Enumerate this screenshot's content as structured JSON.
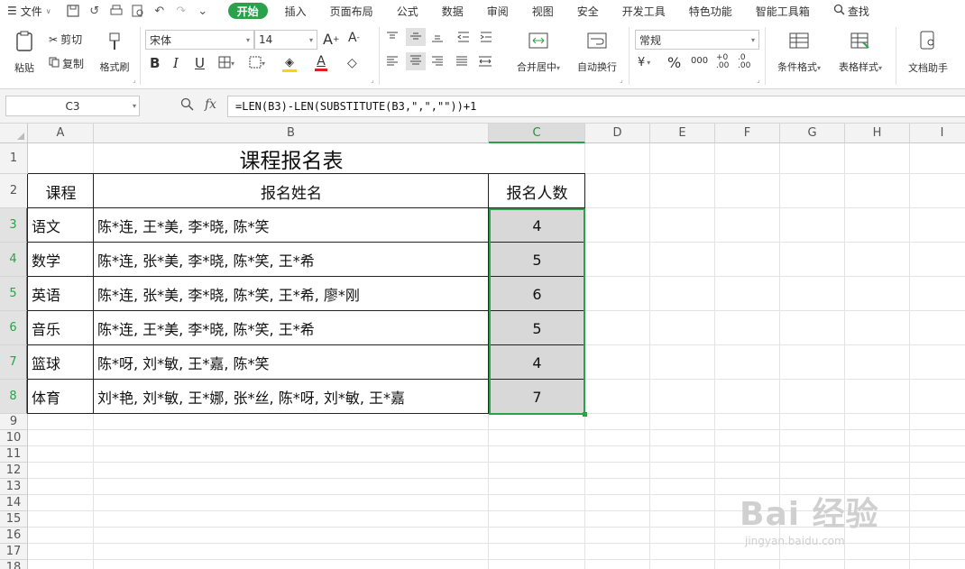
{
  "menubar": {
    "file_label": "文件",
    "tabs": [
      "开始",
      "插入",
      "页面布局",
      "公式",
      "数据",
      "审阅",
      "视图",
      "安全",
      "开发工具",
      "特色功能",
      "智能工具箱"
    ],
    "active_tab": "开始",
    "search_label": "查找"
  },
  "ribbon": {
    "paste": "粘贴",
    "cut": "剪切",
    "copy": "复制",
    "format_painter": "格式刷",
    "font_name": "宋体",
    "font_size": "14",
    "bold": "B",
    "italic": "I",
    "underline": "U",
    "merge_center": "合并居中",
    "wrap_text": "自动换行",
    "number_format": "常规",
    "conditional_format": "条件格式",
    "table_style": "表格样式",
    "doc_assistant": "文档助手",
    "percent": "%",
    "thousands": "000"
  },
  "formula_bar": {
    "name_box": "C3",
    "fx_label": "fx",
    "formula": "=LEN(B3)-LEN(SUBSTITUTE(B3,\",\",\"\"))+1"
  },
  "sheet": {
    "columns": [
      "A",
      "B",
      "C",
      "D",
      "E",
      "F",
      "G",
      "H",
      "I"
    ],
    "rows": [
      "1",
      "2",
      "3",
      "4",
      "5",
      "6",
      "7",
      "8",
      "9",
      "10",
      "11",
      "12",
      "13",
      "14",
      "15",
      "16",
      "17",
      "18"
    ],
    "title": "课程报名表",
    "headers": [
      "课程",
      "报名姓名",
      "报名人数"
    ],
    "data": [
      {
        "course": "语文",
        "names": "陈*连, 王*美, 李*晓, 陈*笑",
        "count": "4"
      },
      {
        "course": "数学",
        "names": "陈*连, 张*美, 李*晓, 陈*笑, 王*希",
        "count": "5"
      },
      {
        "course": "英语",
        "names": "陈*连, 张*美, 李*晓, 陈*笑, 王*希, 廖*刚",
        "count": "6"
      },
      {
        "course": "音乐",
        "names": "陈*连, 王*美, 李*晓, 陈*笑, 王*希",
        "count": "5"
      },
      {
        "course": "篮球",
        "names": "陈*呀, 刘*敏, 王*嘉, 陈*笑",
        "count": "4"
      },
      {
        "course": "体育",
        "names": "刘*艳, 刘*敏, 王*娜, 张*丝, 陈*呀, 刘*敏, 王*嘉",
        "count": "7"
      }
    ]
  },
  "watermark": {
    "brand": "Bai 经验",
    "url": "jingyan.baidu.com"
  },
  "colors": {
    "accent": "#2aa14a"
  }
}
